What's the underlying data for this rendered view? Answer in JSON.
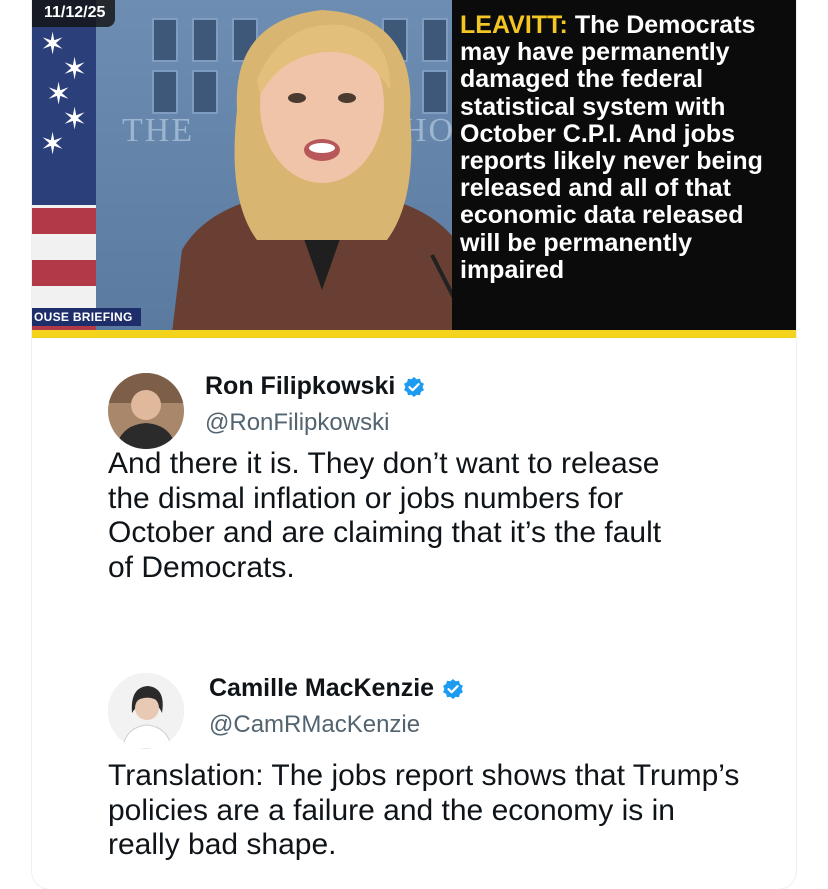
{
  "broadcast": {
    "date": "11/12/25",
    "lower_third": "OUSE BRIEFING",
    "wall_text_left": "THE",
    "wall_text_right": "HOU",
    "caption_speaker": "LEAVITT:",
    "caption_text": "The Democrats may have permanently damaged the federal statistical system with October C.P.I. And jobs reports likely never being released and all of that economic data released will be permanently impaired",
    "accent_color": "#f3d31b"
  },
  "tweets": [
    {
      "name": "Ron Filipkowski",
      "handle": "@RonFilipkowski",
      "verified": true,
      "avatar_icon": "avatar-photo",
      "text": "And there it is. They don’t want to release the dismal inflation or jobs numbers for October and are claiming that it’s the fault of Democrats."
    },
    {
      "name": "Camille MacKenzie",
      "handle": "@CamRMacKenzie",
      "verified": true,
      "avatar_icon": "avatar-photo",
      "text": "Translation: The jobs report shows that Trump’s policies are a failure and the economy is in really bad shape."
    }
  ],
  "colors": {
    "verified_blue": "#1d9bf0",
    "handle_gray": "#536471",
    "text_dark": "#0f1419"
  }
}
